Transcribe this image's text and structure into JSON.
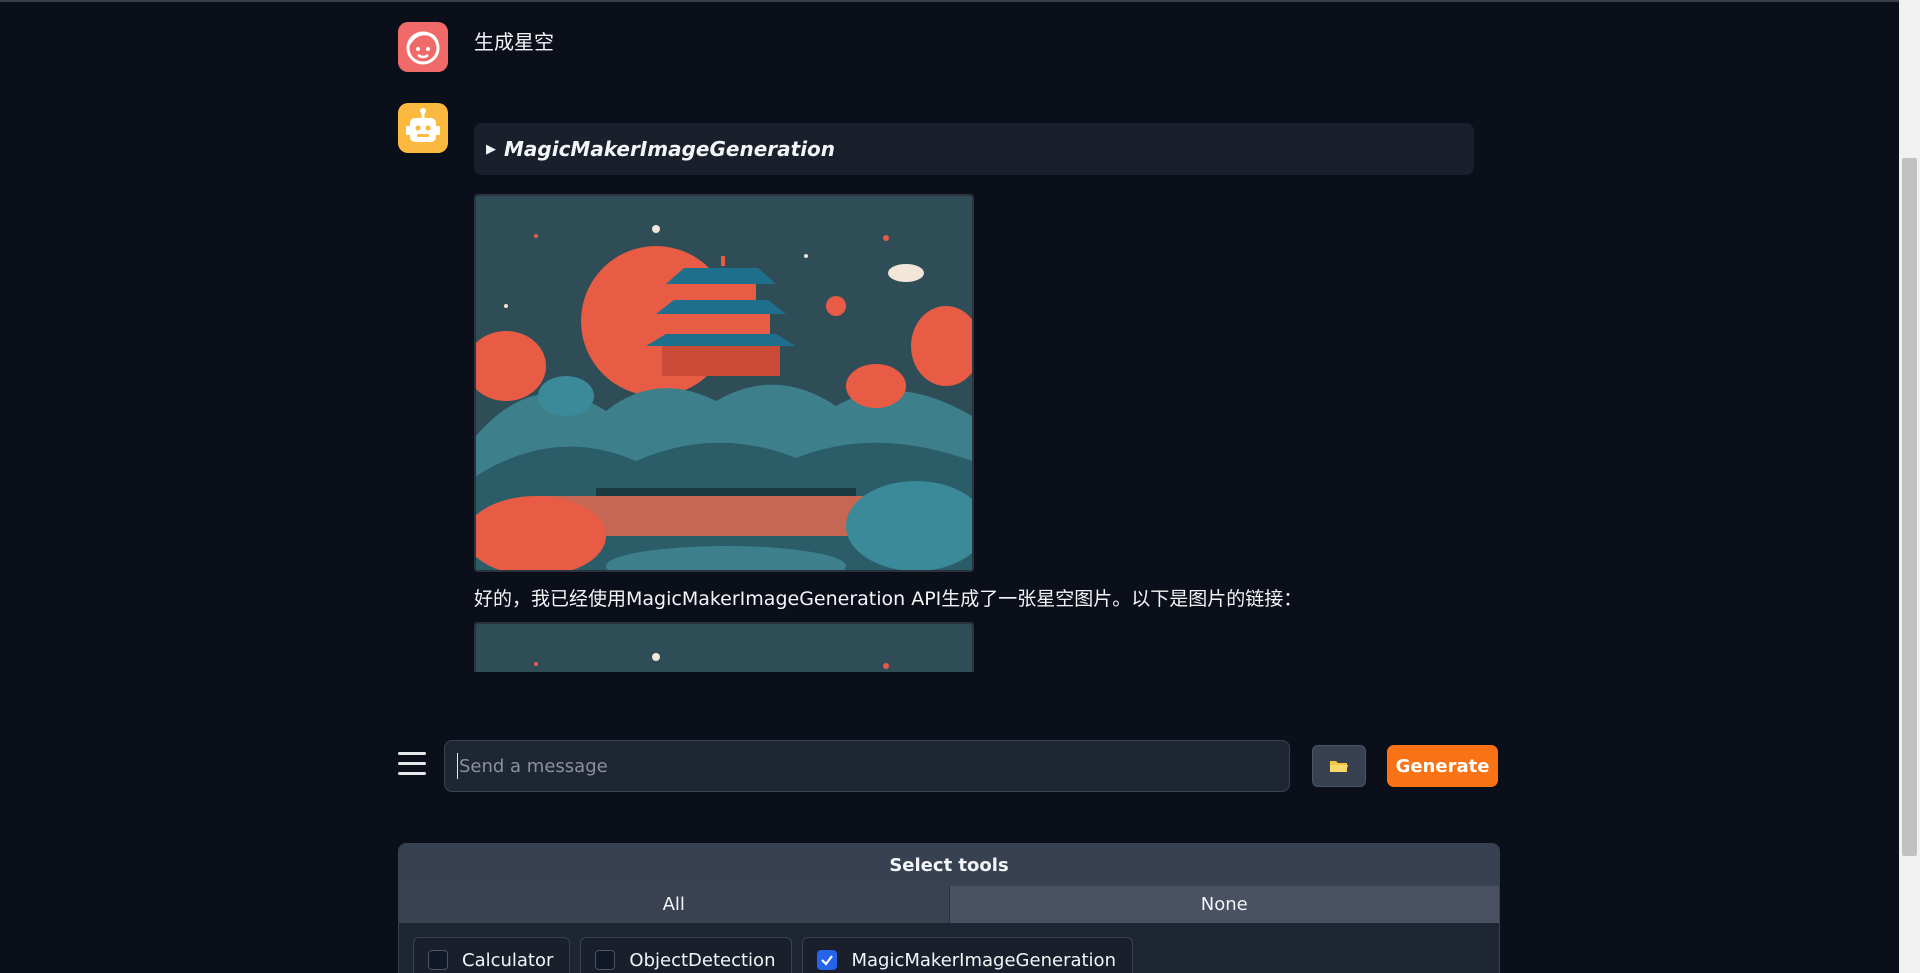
{
  "chat": {
    "user_message": "生成星空",
    "tool_call_name": "MagicMakerImageGeneration",
    "bot_text": "好的，我已经使用MagicMakerImageGeneration API生成了一张星空图片。以下是图片的链接："
  },
  "input": {
    "placeholder": "Send a message",
    "value": ""
  },
  "buttons": {
    "folder_icon": "folder-icon",
    "generate_label": "Generate"
  },
  "tools": {
    "header": "Select tools",
    "tabs": [
      "All",
      "None"
    ],
    "items": [
      {
        "label": "Calculator",
        "checked": false
      },
      {
        "label": "ObjectDetection",
        "checked": false
      },
      {
        "label": "MagicMakerImageGeneration",
        "checked": true
      }
    ]
  },
  "colors": {
    "background": "#0b0f19",
    "accent": "#f97316",
    "user_avatar": "#f16a6a",
    "bot_avatar": "#fbb940",
    "checkbox_checked": "#2563eb"
  }
}
